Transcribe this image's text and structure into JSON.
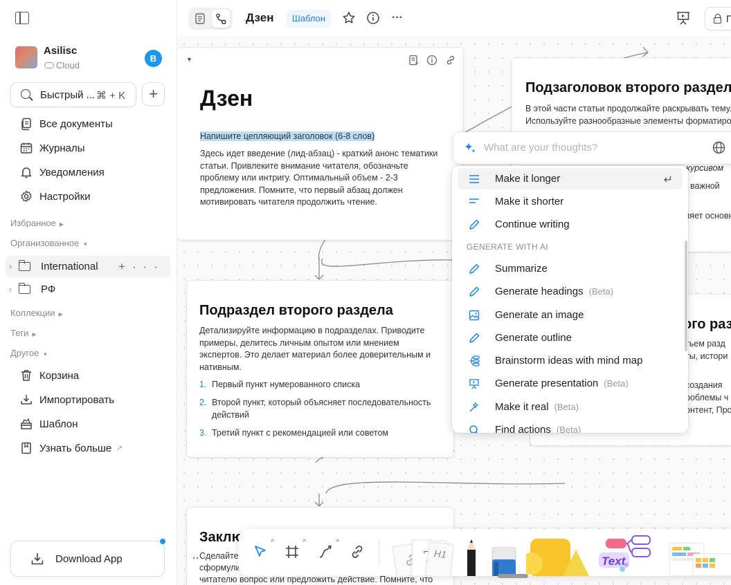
{
  "sidebar": {
    "workspace_name": "Asilisc",
    "workspace_type": "Cloud",
    "user_initial": "B",
    "search_label": "Быстрый ...",
    "search_shortcut": "⌘ + K",
    "nav": [
      {
        "label": "Все документы",
        "icon": "documents-icon"
      },
      {
        "label": "Журналы",
        "icon": "calendar-icon"
      },
      {
        "label": "Уведомления",
        "icon": "bell-icon"
      },
      {
        "label": "Настройки",
        "icon": "gear-icon"
      }
    ],
    "sections": {
      "favorites": "Избранное",
      "organized": "Организованное",
      "collections": "Коллекции",
      "tags": "Теги",
      "other": "Другое"
    },
    "tree": [
      {
        "label": "International"
      },
      {
        "label": "РФ"
      }
    ],
    "other_items": [
      {
        "label": "Корзина",
        "icon": "trash-icon"
      },
      {
        "label": "Импортировать",
        "icon": "import-icon"
      },
      {
        "label": "Шаблон",
        "icon": "template-icon"
      },
      {
        "label": "Узнать больше",
        "icon": "book-icon",
        "suffix": "↗"
      }
    ],
    "download_label": "Download App",
    "accent_color": "#1e96eb"
  },
  "topbar": {
    "title": "Дзен",
    "template_badge": "Шаблон",
    "share_label": "П"
  },
  "canvas": {
    "card_main": {
      "title": "Дзен",
      "subtitle": "Напишите цепляющий заголовок (6-8 слов)",
      "body": "Здесь идет введение (лид-абзац) - краткий анонс тематики статьи. Привлеките внимание читателя, обозначьте проблему или интригу. Оптимальный объем - 2-3 предложения. Помните, что первый абзац должен мотивировать читателя продолжить чтение."
    },
    "card_right_top": {
      "title": "Подзаголовок второго раздела",
      "body": "В этой части статьи продолжайте раскрывать тему. Используйте разнообразные элементы форматиров",
      "frag_italic": "курсивом",
      "frag_bold": "важной",
      "frag_more": "ляет основн"
    },
    "card_sub": {
      "title": "Подраздел второго раздела",
      "body": "Детализируйте информацию в подразделах. Приводите примеры, делитесь личным опытом или мнением экспертов. Это делает материал более доверительным и нативным.",
      "list": [
        {
          "num": "1.",
          "text": "Первый пункт нумерованного списка"
        },
        {
          "num": "2.",
          "text": "Второй пункт, который объясняет последовательность действий"
        },
        {
          "num": "3.",
          "text": "Третий пункт с рекомендацией или советом"
        }
      ]
    },
    "card_right_mid": {
      "title": "ого разд",
      "lines": [
        "тьем разд",
        "ты, истори",
        "",
        "создания",
        "роблемы ч",
        "онтент, Про"
      ]
    },
    "card_bottom": {
      "title": "Заклю",
      "lines": [
        "Сделайте",
        "сформули",
        "читателю вопрос или предложить действие. Помните, что"
      ]
    }
  },
  "ai": {
    "placeholder": "What are your thoughts?",
    "group_label": "GENERATE WITH AI",
    "items_top": [
      {
        "label": "Make it longer",
        "icon": "lines-long-icon",
        "enter": "↵"
      },
      {
        "label": "Make it shorter",
        "icon": "lines-short-icon"
      },
      {
        "label": "Continue writing",
        "icon": "pen-icon"
      }
    ],
    "items_generate": [
      {
        "label": "Summarize",
        "icon": "pen-icon",
        "beta": ""
      },
      {
        "label": "Generate headings",
        "icon": "pen-icon",
        "beta": "(Beta)"
      },
      {
        "label": "Generate an image",
        "icon": "image-icon",
        "beta": ""
      },
      {
        "label": "Generate outline",
        "icon": "pen-icon",
        "beta": ""
      },
      {
        "label": "Brainstorm ideas with mind map",
        "icon": "mindmap-icon",
        "beta": ""
      },
      {
        "label": "Generate presentation",
        "icon": "presentation-icon",
        "beta": "(Beta)"
      },
      {
        "label": "Make it real",
        "icon": "magic-icon",
        "beta": "(Beta)"
      },
      {
        "label": "Find actions",
        "icon": "search-icon",
        "beta": "(Beta)"
      }
    ],
    "accent_color": "#1e84dd"
  },
  "toolbar": {
    "text_label": "Text",
    "h1_label": "H1"
  }
}
